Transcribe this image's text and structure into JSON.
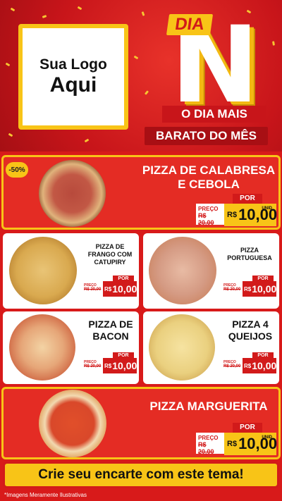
{
  "hero": {
    "logo_line1": "Sua Logo",
    "logo_line2": "Aqui",
    "dia": "DIA",
    "letter": "N",
    "slogan_line1": "O DIA MAIS",
    "slogan_line2": "BARATO DO MÊS"
  },
  "colors": {
    "red": "#d21a1a",
    "yellow": "#f8c417",
    "white": "#ffffff"
  },
  "featured": {
    "discount_badge": "-50%",
    "name_line1": "PIZZA DE CALABRESA",
    "name_line2": "E CEBOLA",
    "por_label": "POR",
    "preco_label": "PREÇO",
    "old_price": "R$ 20,00",
    "currency": "R$",
    "new_price": "10,00",
    "unit": "UNID"
  },
  "items": [
    {
      "name": "PIZZA DE FRANGO COM CATUPIRY",
      "por_label": "POR",
      "preco_label": "PREÇO",
      "old_price": "R$ 20,00",
      "currency": "R$",
      "new_price": "10,00",
      "icon": "pizza-frango-icon"
    },
    {
      "name": "PIZZA PORTUGUESA",
      "por_label": "POR",
      "preco_label": "PREÇO",
      "old_price": "R$ 20,00",
      "currency": "R$",
      "new_price": "10,00",
      "icon": "pizza-portuguesa-icon"
    },
    {
      "name": "PIZZA DE BACON",
      "por_label": "POR",
      "preco_label": "PREÇO",
      "old_price": "R$ 20,00",
      "currency": "R$",
      "new_price": "10,00",
      "icon": "pizza-bacon-icon"
    },
    {
      "name": "PIZZA 4 QUEIJOS",
      "por_label": "POR",
      "preco_label": "PREÇO",
      "old_price": "R$ 20,00",
      "currency": "R$",
      "new_price": "10,00",
      "icon": "pizza-queijos-icon"
    }
  ],
  "bottom": {
    "name": "PIZZA MARGUERITA",
    "por_label": "POR",
    "preco_label": "PREÇO",
    "old_price": "R$ 20,00",
    "currency": "R$",
    "new_price": "10,00",
    "unit": "UNID"
  },
  "cta": "Crie seu encarte com este tema!",
  "disclaimer": "*Imagens Meramente Ilustrativas"
}
